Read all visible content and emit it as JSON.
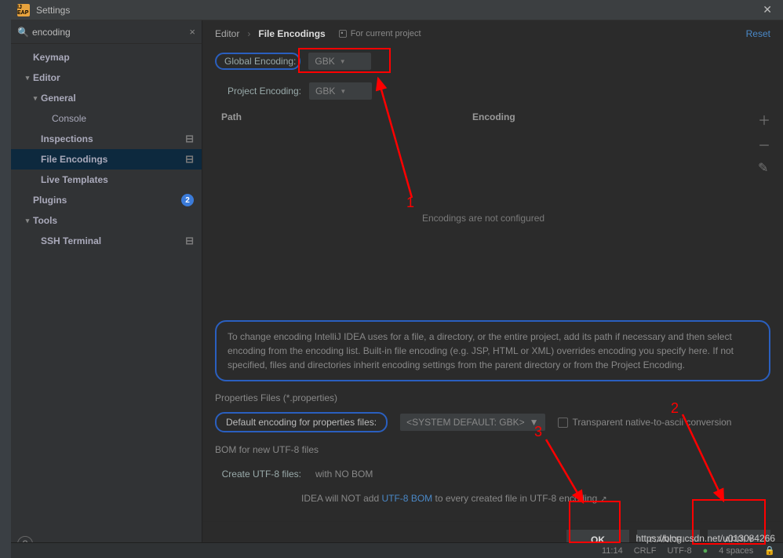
{
  "titlebar": {
    "title": "Settings",
    "icon": "IJ EAP"
  },
  "search": {
    "value": "encoding"
  },
  "sidebar": {
    "items": [
      {
        "label": "Keymap",
        "level": 0,
        "arrow": ""
      },
      {
        "label": "Editor",
        "level": 0,
        "arrow": "▾"
      },
      {
        "label": "General",
        "level": 1,
        "arrow": "▾"
      },
      {
        "label": "Console",
        "level": 2,
        "arrow": ""
      },
      {
        "label": "Inspections",
        "level": 1,
        "arrow": "",
        "settings": true
      },
      {
        "label": "File Encodings",
        "level": 1,
        "arrow": "",
        "settings": true,
        "selected": true
      },
      {
        "label": "Live Templates",
        "level": 1,
        "arrow": ""
      },
      {
        "label": "Plugins",
        "level": 0,
        "arrow": "",
        "badge": "2"
      },
      {
        "label": "Tools",
        "level": 0,
        "arrow": "▾"
      },
      {
        "label": "SSH Terminal",
        "level": 1,
        "arrow": "",
        "settings": true
      }
    ]
  },
  "crumbs": {
    "a": "Editor",
    "b": "File Encodings",
    "for": "For current project",
    "reset": "Reset"
  },
  "encodings": {
    "global_label": "Global Encoding:",
    "global_value": "GBK",
    "project_label": "Project Encoding:",
    "project_value": "GBK"
  },
  "table": {
    "path": "Path",
    "encoding": "Encoding",
    "empty": "Encodings are not configured"
  },
  "info": "To change encoding IntelliJ IDEA uses for a file, a directory, or the entire project, add its path if necessary and then select encoding from the encoding list. Built-in file encoding (e.g. JSP, HTML or XML) overrides encoding you specify here. If not specified, files and directories inherit encoding settings from the parent directory or from the Project Encoding.",
  "props": {
    "title": "Properties Files (*.properties)",
    "default_label": "Default encoding for properties files:",
    "default_value": "<SYSTEM DEFAULT: GBK>",
    "transparent": "Transparent native-to-ascii conversion"
  },
  "bom": {
    "title": "BOM for new UTF-8 files",
    "create_label": "Create UTF-8 files:",
    "create_value": "with NO BOM",
    "note_a": "IDEA will NOT add ",
    "note_link": "UTF-8 BOM",
    "note_b": " to every created file in UTF-8 encoding"
  },
  "buttons": {
    "ok": "OK",
    "cancel": "CANCEL",
    "apply": "APPLY"
  },
  "status": {
    "time": "11:14",
    "crlf": "CRLF",
    "enc": "UTF-8",
    "spaces": "4 spaces"
  },
  "annotations": {
    "n1": "1",
    "n2": "2",
    "n3": "3"
  },
  "watermark": "https://blog.csdn.net/u013084266"
}
